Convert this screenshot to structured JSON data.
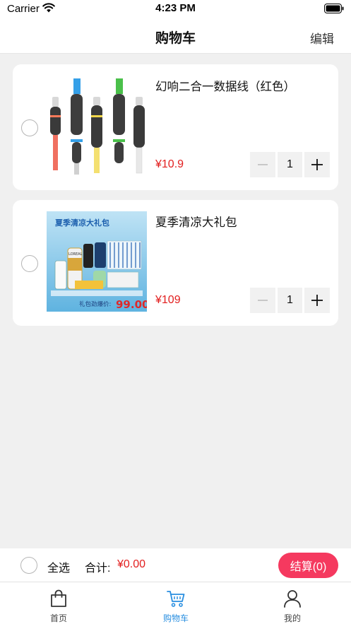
{
  "status_bar": {
    "carrier": "Carrier",
    "time": "4:23 PM"
  },
  "nav": {
    "title": "购物车",
    "edit_label": "编辑"
  },
  "cart_items": [
    {
      "name": "幻响二合一数据线（红色）",
      "price": "¥10.9",
      "quantity": "1"
    },
    {
      "name": "夏季清凉大礼包",
      "price": "¥109",
      "quantity": "1",
      "image_text": {
        "headline": "夏季清凉大礼包",
        "sub": "礼包劲爆价:",
        "price": "99.00",
        "brand": "LOREAL"
      }
    }
  ],
  "footer": {
    "select_all_label": "全选",
    "total_label": "合计:",
    "total_value": "¥0.00",
    "checkout_label": "结算(0)"
  },
  "tabs": [
    {
      "label": "首页",
      "icon": "shopping-bag-icon"
    },
    {
      "label": "购物车",
      "icon": "cart-icon",
      "active": true
    },
    {
      "label": "我的",
      "icon": "person-icon"
    }
  ],
  "colors": {
    "accent": "#f5395f",
    "price": "#e21e1e",
    "tab_active": "#2a8fe0"
  }
}
